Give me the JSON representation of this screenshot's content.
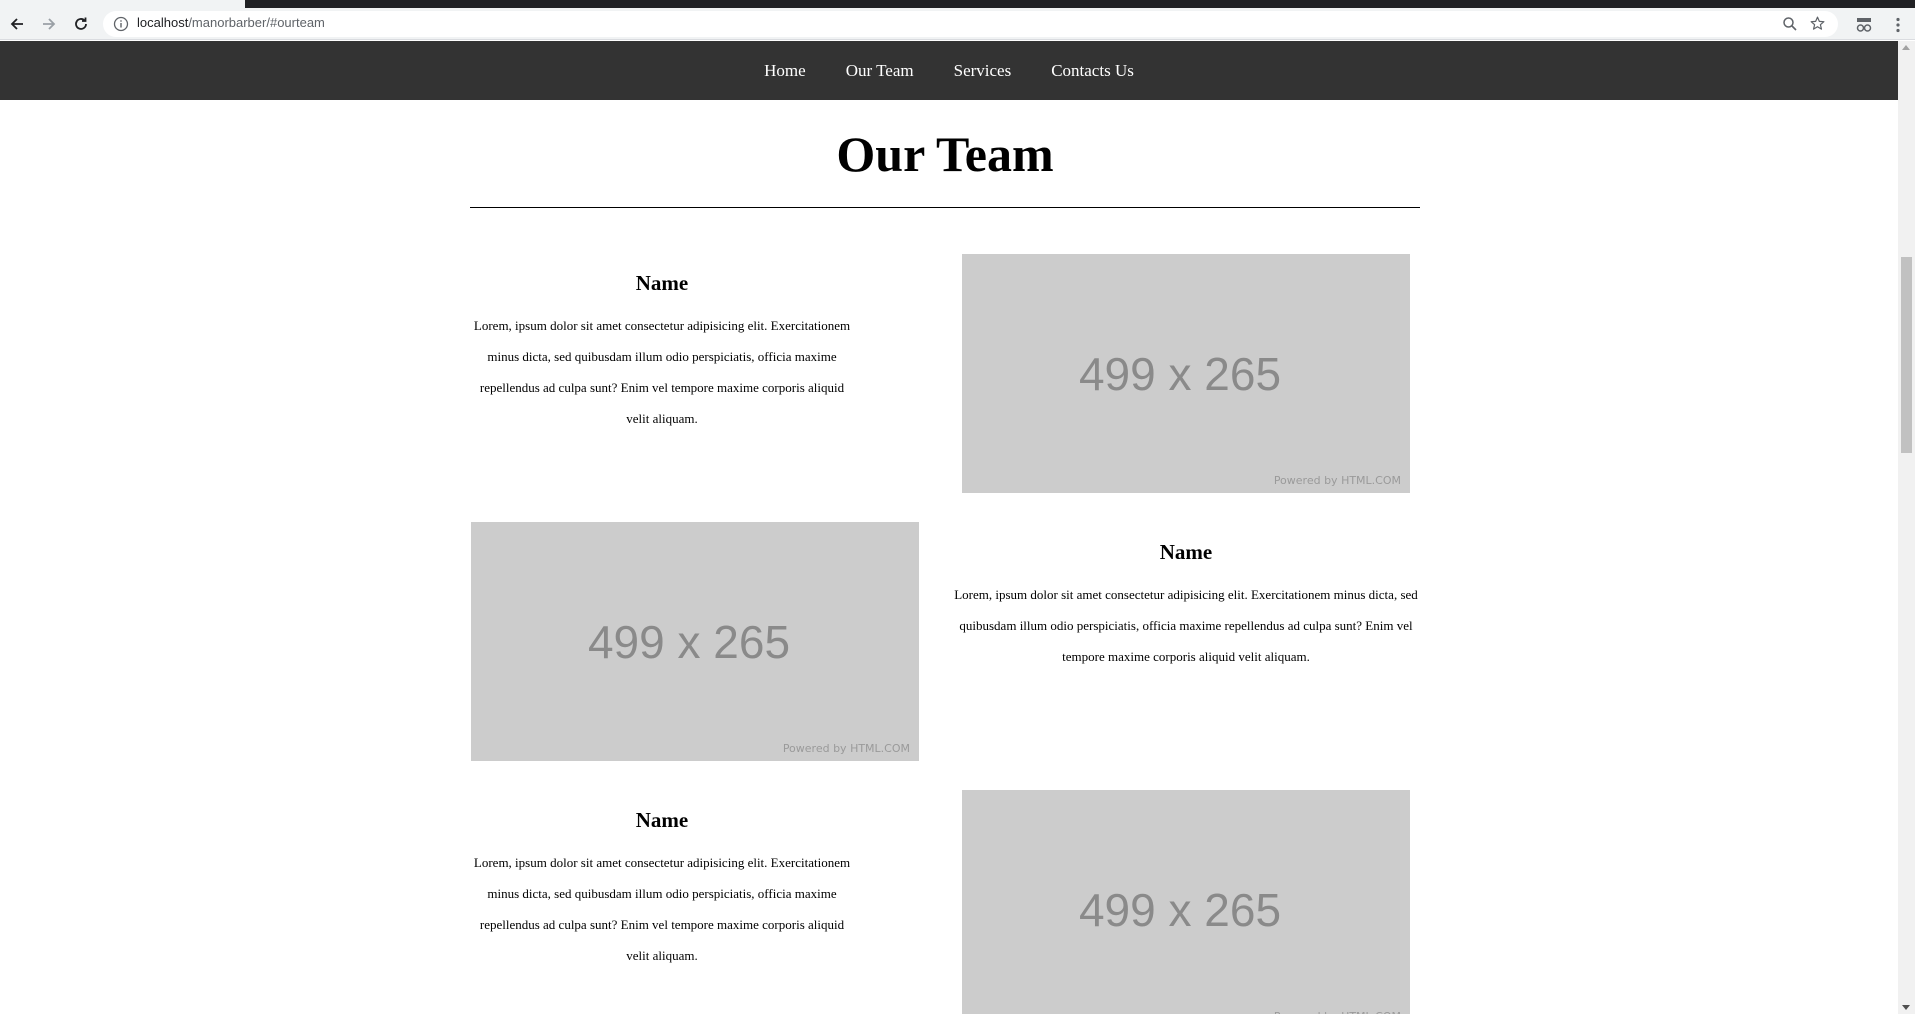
{
  "browser": {
    "url_host": "localhost",
    "url_path": "/manorbarber/#ourteam"
  },
  "nav": {
    "items": [
      "Home",
      "Our Team",
      "Services",
      "Contacts Us"
    ]
  },
  "section": {
    "title": "Our Team"
  },
  "members": [
    {
      "name": "Name",
      "bio": "Lorem, ipsum dolor sit amet consectetur adipisicing elit. Exercitationem minus dicta, sed quibusdam illum odio perspiciatis, officia maxime repellendus ad culpa sunt? Enim vel tempore maxime corporis aliquid velit aliquam."
    },
    {
      "name": "Name",
      "bio": "Lorem, ipsum dolor sit amet consectetur adipisicing elit. Exercitationem minus dicta, sed quibusdam illum odio perspiciatis, officia maxime repellendus ad culpa sunt? Enim vel tempore maxime corporis aliquid velit aliquam."
    },
    {
      "name": "Name",
      "bio": "Lorem, ipsum dolor sit amet consectetur adipisicing elit. Exercitationem minus dicta, sed quibusdam illum odio perspiciatis, officia maxime repellendus ad culpa sunt? Enim vel tempore maxime corporis aliquid velit aliquam."
    }
  ],
  "placeholder": {
    "dims": "499 x 265",
    "powered": "Powered by HTML.COM"
  },
  "colors": {
    "nav_bg": "#333333",
    "placeholder_bg": "#cccccc"
  }
}
